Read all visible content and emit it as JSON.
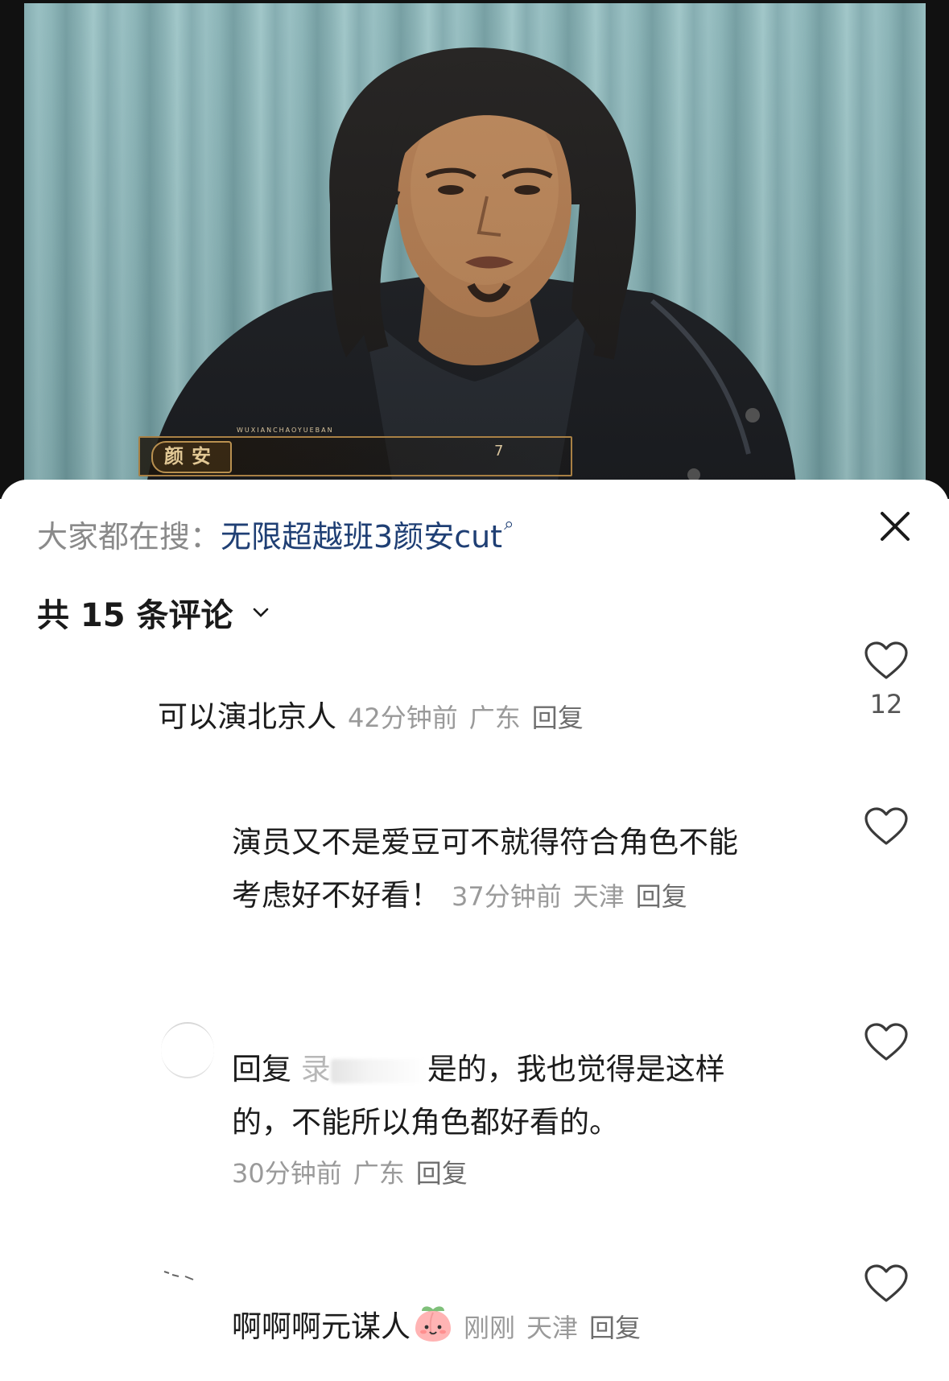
{
  "video": {
    "name_tag": "颜安",
    "tag_subtext": "WUXIANCHAOYUEBAN",
    "tag_mark": "7"
  },
  "search": {
    "prefix": "大家都在搜：",
    "query": "无限超越班3颜安cut",
    "icon": "search-icon"
  },
  "comments_header": {
    "count_label": "共 15 条评论",
    "sort_icon": "chevron-down-icon"
  },
  "comments": [
    {
      "text": "可以演北京人",
      "time": "42分钟前",
      "location": "广东",
      "reply_label": "回复",
      "likes": "12"
    },
    {
      "line1": "演员又不是爱豆可不就得符合角色不能",
      "line2": "考虑好不好看！",
      "time": "37分钟前",
      "location": "天津",
      "reply_label": "回复"
    },
    {
      "reply_prefix": "回复",
      "mention_initial": "录",
      "line1_rest": "是的，我也觉得是这样",
      "line2": "的，不能所以角色都好看的。",
      "time": "30分钟前",
      "location": "广东",
      "reply_label": "回复"
    },
    {
      "text": "啊啊啊元谋人",
      "emoji": "peach-emoji",
      "time": "刚刚",
      "location": "天津",
      "reply_label": "回复"
    }
  ],
  "colors": {
    "query": "#1f3f74",
    "meta": "#9a9a9a",
    "text": "#1c1c1c",
    "curtain": "#86b1b4"
  }
}
